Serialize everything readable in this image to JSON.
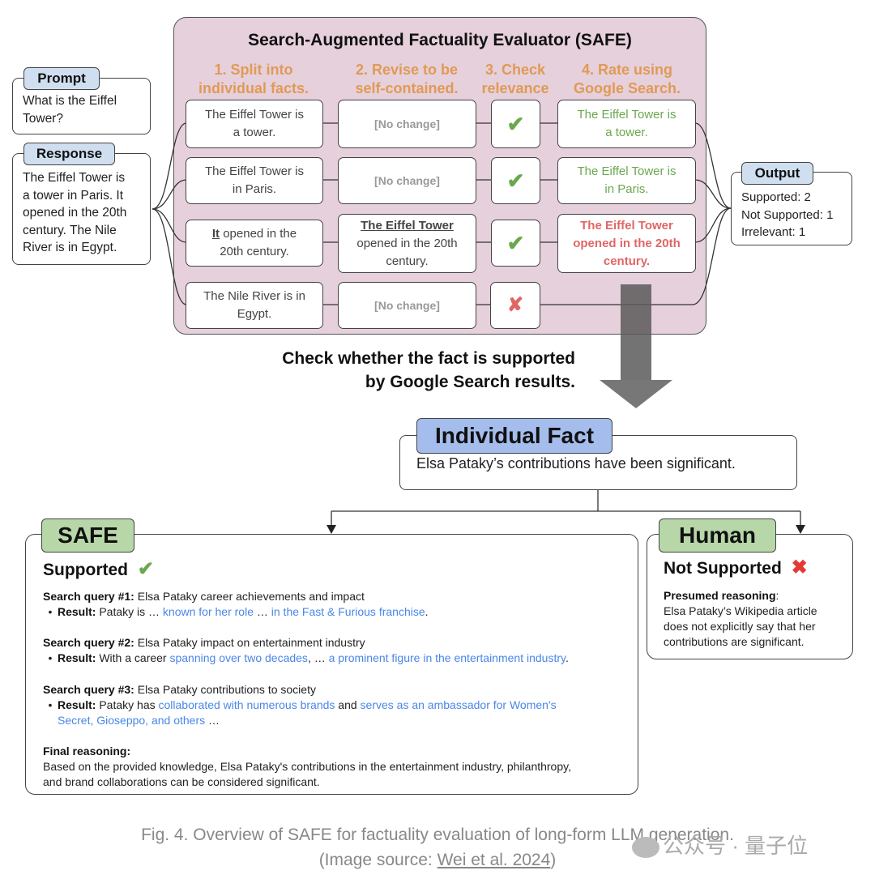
{
  "safe_panel": {
    "title": "Search-Augmented Factuality Evaluator (SAFE)",
    "steps": [
      {
        "line1": "1. Split into",
        "line2": "individual facts."
      },
      {
        "line1": "2. Revise to be",
        "line2": "self-contained."
      },
      {
        "line1": "3. Check",
        "line2": "relevance"
      },
      {
        "line1": "4. Rate using",
        "line2": "Google Search."
      }
    ],
    "rows": [
      {
        "fact_l1": "The Eiffel Tower is",
        "fact_l2": "a tower.",
        "revised": "[No change]",
        "relevance": "check-icon",
        "rating_l1": "The Eiffel Tower is",
        "rating_l2": "a tower.",
        "rating_l3": "",
        "rating_status": "supported"
      },
      {
        "fact_l1": "The Eiffel Tower is",
        "fact_l2": "in Paris.",
        "revised": "[No change]",
        "relevance": "check-icon",
        "rating_l1": "The Eiffel Tower is",
        "rating_l2": "in Paris.",
        "rating_l3": "",
        "rating_status": "supported"
      },
      {
        "fact_pre": "It",
        "fact_l1": " opened in the",
        "fact_l2": "20th century.",
        "revised_emph": "The Eiffel Tower",
        "revised_l2": "opened in the 20th",
        "revised_l3": "century.",
        "relevance": "check-icon",
        "rating_l1": "The Eiffel Tower",
        "rating_l2": "opened in the 20th",
        "rating_l3": "century.",
        "rating_status": "not-supported"
      },
      {
        "fact_l1": "The Nile River is in",
        "fact_l2": "Egypt.",
        "revised": "[No change]",
        "relevance": "cross-icon"
      }
    ]
  },
  "prompt": {
    "tag": "Prompt",
    "l1": "What is the Eiffel",
    "l2": "Tower?"
  },
  "response": {
    "tag": "Response",
    "lines": [
      "The Eiffel Tower is",
      "a tower in Paris. It",
      "opened in the 20th",
      "century. The Nile",
      "River is in Egypt."
    ]
  },
  "output": {
    "tag": "Output",
    "lines": [
      "Supported: 2",
      "Not Supported: 1",
      "Irrelevant: 1"
    ]
  },
  "check_question": {
    "l1": "Check whether the fact is supported",
    "l2": "by Google Search results."
  },
  "individual_fact": {
    "tag": "Individual Fact",
    "text": "Elsa Pataky’s contributions have been significant."
  },
  "safe_result": {
    "tag": "SAFE",
    "verdict": "Supported",
    "verdict_icon": "check-icon",
    "queries": [
      {
        "label": "Search query #1:",
        "query": " Elsa Pataky career achievements and impact",
        "result_label": "Result:",
        "parts": [
          " Pataky is … ",
          "known for her role",
          " … ",
          "in the Fast & Furious franchise",
          "."
        ]
      },
      {
        "label": "Search query #2:",
        "query": " Elsa Pataky impact on entertainment industry",
        "result_label": "Result:",
        "parts": [
          " With a career ",
          "spanning over two decades",
          ", … ",
          "a prominent figure in the entertainment industry",
          "."
        ]
      },
      {
        "label": "Search query #3:",
        "query": " Elsa Pataky contributions to society",
        "result_label": "Result:",
        "parts": [
          " Pataky has ",
          "collaborated with numerous brands",
          " and ",
          "serves as an ambassador for Women's",
          "Secret, Gioseppo, and others",
          " …"
        ]
      }
    ],
    "final_label": "Final reasoning:",
    "final_l1": "Based on the provided knowledge, Elsa Pataky's contributions in the entertainment industry, philanthropy,",
    "final_l2": "and brand collaborations can be considered significant."
  },
  "human_result": {
    "tag": "Human",
    "verdict": "Not Supported",
    "verdict_icon": "cross-icon",
    "reason_label": "Presumed reasoning",
    "reason_colon": ":",
    "reason_lines": [
      "Elsa Pataky’s Wikipedia article",
      "does not explicitly say that her",
      "contributions are significant."
    ]
  },
  "caption": {
    "l1": "Fig. 4. Overview of SAFE for factuality evaluation of long-form LLM generation.",
    "l2_pre": "(Image source: ",
    "l2_link": "Wei et al. 2024",
    "l2_post": ")"
  },
  "watermark": "公众号 · 量子位",
  "colors": {
    "step_orange": "#e09a55",
    "supported_green": "#6aa84f",
    "not_supported_red": "#e06666",
    "link_blue": "#4a86e8",
    "panel_pink": "#e6d0dc",
    "tag_blue": "#cfdff0",
    "fact_tag_blue": "#a4bdec",
    "tag_green": "#b7d7a8"
  }
}
